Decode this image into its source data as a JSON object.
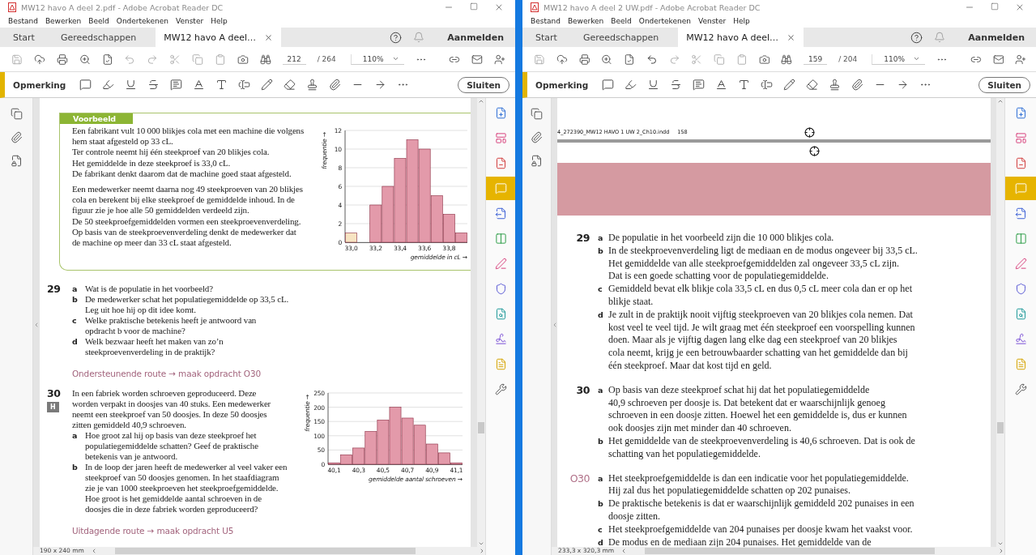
{
  "windows": [
    {
      "title": "MW12 havo A deel 2.pdf - Adobe Acrobat Reader DC",
      "menu": [
        "Bestand",
        "Bewerken",
        "Beeld",
        "Ondertekenen",
        "Venster",
        "Help"
      ],
      "tabs": [
        {
          "label": "Start",
          "selected": false,
          "closable": false
        },
        {
          "label": "Gereedschappen",
          "selected": false,
          "closable": false
        },
        {
          "label": "MW12 havo A deel…",
          "selected": true,
          "closable": true
        }
      ],
      "sign_in": "Aanmelden",
      "page_number": "212",
      "page_count": "/ 264",
      "zoom": "110%",
      "undo_enabled": false,
      "comment_label": "Opmerking",
      "close_label": "Sluiten",
      "page_size": "190 x 240 mm",
      "tool_panel": [
        {
          "selected": false
        },
        {
          "selected": false
        },
        {
          "selected": false
        },
        {
          "selected": true
        },
        {
          "selected": false
        },
        {
          "selected": false
        },
        {
          "selected": false
        },
        {
          "selected": false
        },
        {
          "selected": false
        },
        {
          "selected": false
        },
        {
          "selected": false
        },
        {
          "selected": false
        }
      ],
      "page": [
        {
          "kind": "example",
          "title": "Voorbeeld",
          "paragraphs": [
            [
              "Een fabrikant vult 10 000 blikjes cola met een machine die volgens",
              "hem staat afgesteld op 33 cL.",
              "Ter controle neemt hij één steekproef van 20 blikjes cola.",
              "Het gemiddelde in deze steekproef is 33,0 cL.",
              "De fabrikant denkt daarom dat de machine goed staat afgesteld."
            ],
            [
              "Een medewerker neemt daarna nog 49 steekproeven van 20 blikjes",
              "cola en berekent bij elke steekproef de gemiddelde inhoud. In de",
              "figuur zie je hoe alle 50 gemiddelden verdeeld zijn.",
              "De 50 steekproefgemiddelden vormen een steekproevenverdeling.",
              "Op basis van de steekproevenverdeling denkt de medewerker dat",
              "de machine op meer dan 33 cL staat afgesteld."
            ]
          ],
          "chart_data": {
            "type": "bar",
            "xlabel": "gemiddelde in cL →",
            "ylabel": "frequentie →",
            "x": [
              33.0,
              33.1,
              33.2,
              33.3,
              33.4,
              33.5,
              33.6,
              33.7,
              33.8,
              33.9
            ],
            "stacked": true,
            "series": [
              {
                "color": "#f7e4c2",
                "values": [
                  1,
                  null,
                  null,
                  null,
                  null,
                  null,
                  null,
                  null,
                  null,
                  null
                ]
              },
              {
                "color": "#e39aaa",
                "values": [
                  null,
                  null,
                  4,
                  6,
                  9,
                  11,
                  10,
                  5,
                  3,
                  1
                ]
              }
            ],
            "grid": true,
            "xlim": [
              32.95,
              33.95
            ],
            "ylim": [
              0,
              12
            ],
            "yticks": [
              0,
              2,
              4,
              6,
              8,
              10,
              12
            ],
            "xticks": [
              {
                "value": 33.0,
                "label": "33,0"
              },
              {
                "value": 33.2,
                "label": "33,2"
              },
              {
                "value": 33.4,
                "label": "33,4"
              },
              {
                "value": 33.6,
                "label": "33,6"
              },
              {
                "value": 33.8,
                "label": "33,8"
              }
            ]
          }
        },
        {
          "kind": "question",
          "number": "29",
          "items": [
            {
              "letter": "a",
              "lines": [
                "Wat is de populatie in het voorbeeld?"
              ]
            },
            {
              "letter": "b",
              "lines": [
                "De medewerker schat het populatiegemiddelde op 33,5 cL.",
                "Leg uit hoe hij op dit idee komt."
              ]
            },
            {
              "letter": "c",
              "lines": [
                "Welke praktische betekenis heeft je antwoord van",
                "opdracht b voor de machine?"
              ]
            },
            {
              "letter": "d",
              "lines": [
                "Welk bezwaar heeft het maken van zo’n",
                "steekproevenverdeling in de praktijk?"
              ]
            }
          ]
        },
        {
          "kind": "route",
          "text": "Ondersteunende route → maak opdracht O30"
        },
        {
          "kind": "question",
          "number": "30",
          "badge": "H",
          "intro": [
            "In een fabriek worden schroeven geproduceerd. Deze",
            "worden verpakt in doosjes van 40 stuks. Een medewerker",
            "neemt een steekproef van 50 doosjes. In deze 50 doosjes",
            "zitten gemiddeld 40,9 schroeven."
          ],
          "items": [
            {
              "letter": "a",
              "lines": [
                "Hoe groot zal hij op basis van deze steekproef het",
                "populatiegemiddelde schatten? Geef de praktische",
                "betekenis van je antwoord."
              ]
            },
            {
              "letter": "b",
              "lines": [
                "In de loop der jaren heeft de medewerker al veel vaker een",
                "steekproef van 50 doosjes genomen. In het staafdiagram",
                "zie je van 1000 steekproeven het steekproefgemiddelde.",
                "Hoe groot is het gemiddelde aantal schroeven in de",
                "doosjes die in deze fabriek worden geproduceerd?"
              ]
            }
          ],
          "chart_data": {
            "type": "bar",
            "xlabel": "gemiddelde aantal schroeven →",
            "ylabel": "frequentie →",
            "x": [
              40.1,
              40.2,
              40.3,
              40.4,
              40.5,
              40.6,
              40.7,
              40.8,
              40.9,
              41.0,
              41.1
            ],
            "stacked": false,
            "series": [
              {
                "color": "#e39aaa",
                "values": [
                  5,
                  33,
                  57,
                  115,
                  155,
                  200,
                  162,
                  137,
                  71,
                  40,
                  5
                ]
              }
            ],
            "grid": true,
            "xlim": [
              40.05,
              41.15
            ],
            "ylim": [
              0,
              250
            ],
            "yticks": [
              0,
              50,
              100,
              150,
              200,
              250
            ],
            "xticks": [
              {
                "value": 40.1,
                "label": "40,1"
              },
              {
                "value": 40.3,
                "label": "40,3"
              },
              {
                "value": 40.5,
                "label": "40,5"
              },
              {
                "value": 40.7,
                "label": "40,7"
              },
              {
                "value": 40.9,
                "label": "40,9"
              },
              {
                "value": 41.1,
                "label": "41,1"
              }
            ]
          }
        },
        {
          "kind": "route",
          "text": "Uitdagende route → maak opdracht U5"
        }
      ]
    },
    {
      "title": "MW12 havo A deel 2 UW.pdf - Adobe Acrobat Reader DC",
      "menu": [
        "Bestand",
        "Bewerken",
        "Beeld",
        "Ondertekenen",
        "Venster",
        "Help"
      ],
      "tabs": [
        {
          "label": "Start",
          "selected": false,
          "closable": false
        },
        {
          "label": "Gereedschappen",
          "selected": false,
          "closable": false
        },
        {
          "label": "MW12 havo A deel…",
          "selected": true,
          "closable": true
        }
      ],
      "sign_in": "Aanmelden",
      "page_number": "159",
      "page_count": "/ 204",
      "zoom": "110%",
      "undo_enabled": true,
      "comment_label": "Opmerking",
      "close_label": "Sluiten",
      "page_size": "233,3 x 320,3 mm",
      "tool_panel": [
        {
          "selected": false
        },
        {
          "selected": false
        },
        {
          "selected": false
        },
        {
          "selected": true
        },
        {
          "selected": false
        },
        {
          "selected": false
        },
        {
          "selected": false
        },
        {
          "selected": false
        },
        {
          "selected": false
        },
        {
          "selected": false
        },
        {
          "selected": false
        },
        {
          "selected": false
        }
      ],
      "page": [
        {
          "kind": "print_mark",
          "file": "4_272390_MW12 HAVO 1 UW 2_Ch10.indd",
          "page": "158"
        },
        {
          "kind": "banner"
        },
        {
          "kind": "answer",
          "number": "29",
          "support": false,
          "items": [
            {
              "letter": "a",
              "lines": [
                "De populatie in het voorbeeld zijn die 10 000 blikjes cola."
              ]
            },
            {
              "letter": "b",
              "lines": [
                "In de steekproevenverdeling ligt de mediaan en de modus ongeveer bij 33,5 cL.",
                "Het gemiddelde van alle steekproefgemiddelden zal ongeveer 33,5 cL zijn.",
                "Dat is een goede schatting voor de populatiegemiddelde."
              ]
            },
            {
              "letter": "c",
              "lines": [
                "Gemiddeld bevat elk blikje cola 33,5 cL en dus 0,5 cL meer cola dan er op het",
                "blikje staat."
              ]
            },
            {
              "letter": "d",
              "lines": [
                "Je zult in de praktijk nooit vijftig steekproeven van 20 blikjes cola nemen. Dat",
                "kost veel te veel tijd. Je wilt graag met één steekproef een voorspelling kunnen",
                "doen. Maar als je vijftig dagen lang elke dag een steekproef van 20 blikjes",
                "cola neemt, krijg je een betrouwbaarder schatting van het gemiddelde dan bij",
                "één steekproef. Maar dat kost tijd en geld."
              ]
            }
          ]
        },
        {
          "kind": "answer",
          "number": "30",
          "support": false,
          "items": [
            {
              "letter": "a",
              "lines": [
                "Op basis van deze steekproef schat hij dat het populatiegemiddelde",
                "40,9 schroeven per doosje is. Dat betekent dat er waarschijnlijk genoeg",
                "schroeven in een doosje zitten. Hoewel het een gemiddelde is, dus er kunnen",
                "ook doosjes zijn met minder dan 40 schroeven."
              ]
            },
            {
              "letter": "b",
              "lines": [
                "Het gemiddelde van de steekproevenverdeling is 40,6 schroeven. Dat is ook de",
                "schatting van het populatiegemiddelde."
              ]
            }
          ]
        },
        {
          "kind": "answer",
          "number": "O30",
          "support": true,
          "items": [
            {
              "letter": "a",
              "lines": [
                "Het steekproefgemiddelde is dan een indicatie voor het populatiegemiddelde.",
                "Hij zal dus het populatiegemiddelde schatten op 202 punaises."
              ]
            },
            {
              "letter": "b",
              "lines": [
                "De praktische betekenis is dat er waarschijnlijk gemiddeld 202 punaises in een",
                "doosje zitten."
              ]
            },
            {
              "letter": "c",
              "lines": [
                "Het steekproefgemiddelde van 204 punaises per doosje kwam het vaakst voor."
              ]
            },
            {
              "letter": "d",
              "lines": [
                "De modus en de mediaan zijn 204 punaises. Het gemiddelde van de"
              ]
            }
          ]
        }
      ]
    }
  ]
}
